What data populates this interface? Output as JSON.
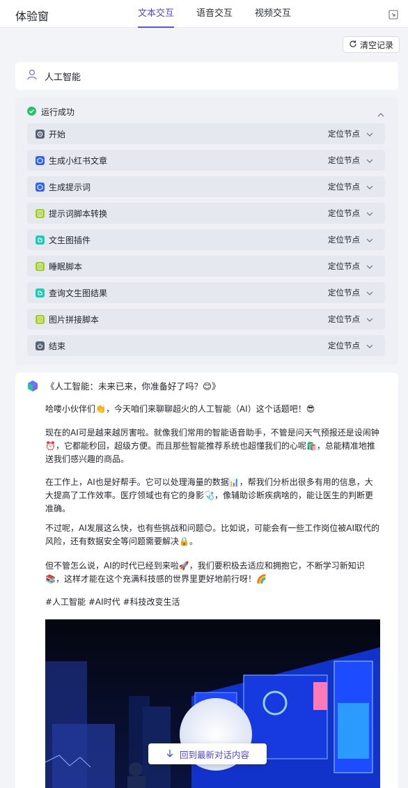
{
  "app": {
    "title": "体验窗"
  },
  "tabs": [
    {
      "label": "文本交互",
      "active": true
    },
    {
      "label": "语音交互",
      "active": false
    },
    {
      "label": "视频交互",
      "active": false
    }
  ],
  "toolbar": {
    "clear_label": "清空记录"
  },
  "query": {
    "text": "人工智能"
  },
  "run": {
    "status": "运行成功",
    "nodes": [
      {
        "label": "开始",
        "action": "定位节点",
        "icon": "start-icon",
        "color": "#5a6275"
      },
      {
        "label": "生成小红书文章",
        "action": "定位节点",
        "icon": "llm-icon",
        "color": "#3563e9"
      },
      {
        "label": "生成提示词",
        "action": "定位节点",
        "icon": "llm-icon",
        "color": "#3563e9"
      },
      {
        "label": "提示词脚本转换",
        "action": "定位节点",
        "icon": "code-icon",
        "color": "#9fd21c"
      },
      {
        "label": "文生图插件",
        "action": "定位节点",
        "icon": "plugin-icon",
        "color": "#1fc9b7"
      },
      {
        "label": "睡眠脚本",
        "action": "定位节点",
        "icon": "code-icon",
        "color": "#9fd21c"
      },
      {
        "label": "查询文生图结果",
        "action": "定位节点",
        "icon": "plugin-icon",
        "color": "#1fc9b7"
      },
      {
        "label": "图片拼接脚本",
        "action": "定位节点",
        "icon": "code-icon",
        "color": "#9fd21c"
      },
      {
        "label": "结束",
        "action": "定位节点",
        "icon": "end-icon",
        "color": "#5a6275"
      }
    ]
  },
  "answer": {
    "title": "《人工智能：未来已来，你准备好了吗？😊》",
    "paragraphs": [
      "哈喽小伙伴们👏，今天咱们来聊聊超火的人工智能（AI）这个话题吧！😎",
      "现在的AI可是越来越厉害啦。就像我们常用的智能语音助手，不管是问天气预报还是设闹钟⏰，它都能秒回，超级方便。而且那些智能推荐系统也超懂我们的心呢🛍️，总能精准地推送我们感兴趣的商品。",
      "在工作上，AI也是好帮手。它可以处理海量的数据📊，帮我们分析出很多有用的信息，大大提高了工作效率。医疗领域也有它的身影🩺，像辅助诊断疾病啥的，能让医生的判断更准确。",
      "不过呢，AI发展这么快，也有些挑战和问题😊。比如说，可能会有一些工作岗位被AI取代的风险，还有数据安全等问题需要解决🔒。",
      "但不管怎么说，AI的时代已经到来啦🚀，我们要积极去适应和拥抱它，不断学习新知识📚，这样才能在这个充满科技感的世界里更好地前行呀！🌈",
      "#人工智能 #AI时代 #科技改变生活"
    ]
  },
  "scroll_button": {
    "label": "回到最新对话内容"
  }
}
